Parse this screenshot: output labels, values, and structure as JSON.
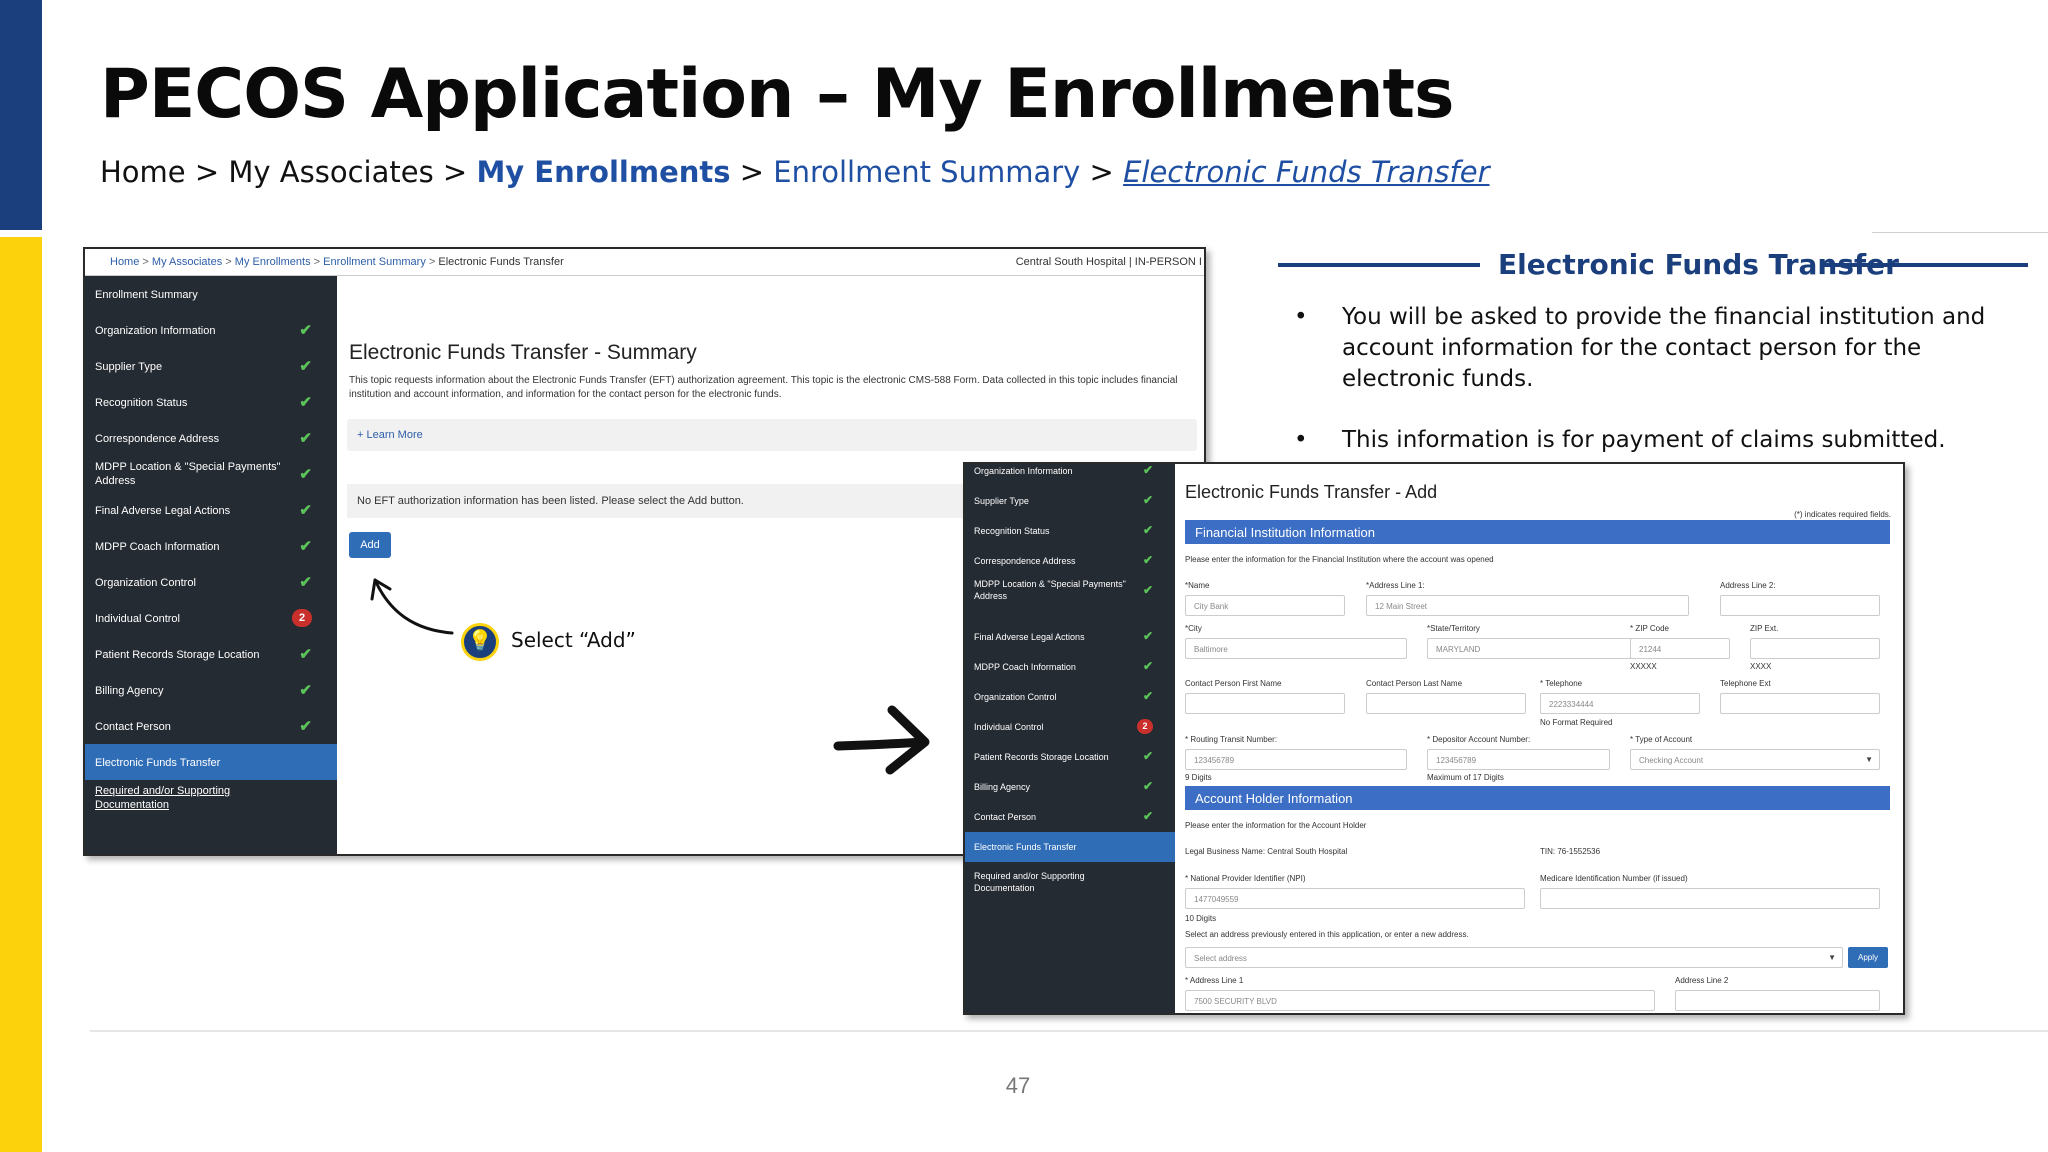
{
  "slide": {
    "title": "PECOS Application – My Enrollments",
    "page_number": "47",
    "colors": {
      "navy": "#1b3f7d",
      "yellow": "#fcd20c",
      "link_blue": "#1f4fa3"
    }
  },
  "breadcrumb": {
    "home": "Home",
    "my_associates": "My Associates",
    "my_enrollments": "My Enrollments",
    "enrollment_summary": "Enrollment Summary",
    "eft": "Electronic Funds Transfer",
    "separator": ">"
  },
  "info_panel": {
    "heading": "Electronic Funds Transfer",
    "bullets": [
      "You will be asked to provide the financial institution and account information for the contact person for the electronic funds.",
      "This information is for payment of claims submitted."
    ],
    "bullet_glyph": "•"
  },
  "annotation": {
    "text": "Select “Add”",
    "icon": "lightbulb-icon"
  },
  "screen1": {
    "breadcrumb": [
      "Home",
      "My Associates",
      "My Enrollments",
      "Enrollment Summary",
      "Electronic Funds Transfer"
    ],
    "org": "Central South Hospital  |  IN-PERSON I",
    "sidebar": [
      {
        "label": "Enrollment Summary",
        "status": ""
      },
      {
        "label": "Organization Information",
        "status": "check"
      },
      {
        "label": "Supplier Type",
        "status": "check"
      },
      {
        "label": "Recognition Status",
        "status": "check"
      },
      {
        "label": "Correspondence Address",
        "status": "check"
      },
      {
        "label": "MDPP Location & \"Special Payments\" Address",
        "status": "check"
      },
      {
        "label": "Final Adverse Legal Actions",
        "status": "check"
      },
      {
        "label": "MDPP Coach Information",
        "status": "check"
      },
      {
        "label": "Organization Control",
        "status": "check"
      },
      {
        "label": "Individual Control",
        "status": "2"
      },
      {
        "label": "Patient Records Storage Location",
        "status": "check"
      },
      {
        "label": "Billing Agency",
        "status": "check"
      },
      {
        "label": "Contact Person",
        "status": "check"
      },
      {
        "label": "Electronic Funds Transfer",
        "status": "active"
      },
      {
        "label": "Required and/or Supporting Documentation",
        "status": "link"
      }
    ],
    "page_title": "Electronic Funds Transfer - Summary",
    "description": "This topic requests information about the Electronic Funds Transfer (EFT) authorization agreement. This topic is the electronic CMS-588 Form. Data collected in this topic includes financial institution and account information, and information for the contact person for the electronic funds.",
    "learn_more": "+ Learn More",
    "empty_note": "No EFT authorization information has been listed. Please select the Add button.",
    "add_button": "Add"
  },
  "screen2": {
    "sidebar": [
      {
        "label": "Organization Information",
        "status": "check"
      },
      {
        "label": "Supplier Type",
        "status": "check"
      },
      {
        "label": "Recognition Status",
        "status": "check"
      },
      {
        "label": "Correspondence Address",
        "status": "check"
      },
      {
        "label": "MDPP Location & \"Special Payments\" Address",
        "status": "check"
      },
      {
        "label": "Final Adverse Legal Actions",
        "status": "check"
      },
      {
        "label": "MDPP Coach Information",
        "status": "check"
      },
      {
        "label": "Organization Control",
        "status": "check"
      },
      {
        "label": "Individual Control",
        "status": "2"
      },
      {
        "label": "Patient Records Storage Location",
        "status": "check"
      },
      {
        "label": "Billing Agency",
        "status": "check"
      },
      {
        "label": "Contact Person",
        "status": "check"
      },
      {
        "label": "Electronic Funds Transfer",
        "status": "active"
      },
      {
        "label": "Required and/or Supporting Documentation",
        "status": ""
      }
    ],
    "page_title": "Electronic Funds Transfer - Add",
    "required_note": "(*) indicates required fields.",
    "fin_section": "Financial Institution Information",
    "fin_intro": "Please enter the information for the Financial Institution where the account was opened",
    "labels": {
      "name": "*Name",
      "addr1": "*Address Line 1:",
      "addr2": "Address Line 2:",
      "city": "*City",
      "state": "*State/Territory",
      "zip": "* ZIP Code",
      "zip_ext": "ZIP Ext.",
      "cp_first": "Contact Person First Name",
      "cp_last": "Contact Person Last Name",
      "telephone": "* Telephone",
      "tel_ext": "Telephone Ext",
      "routing": "* Routing Transit Number:",
      "depositor": "* Depositor Account Number:",
      "acct_type": "* Type of Account",
      "legal_name": "Legal Business Name: Central South Hospital",
      "tin": "TIN: 76-1552536",
      "npi": "* National Provider Identifier (NPI)",
      "medicare_id": "Medicare Identification Number (if issued)",
      "select_addr_intro": "Select an address previously entered in this application, or enter a new address.",
      "ah_addr1": "* Address Line 1",
      "ah_addr2": "Address Line 2"
    },
    "placeholders": {
      "name": "City Bank",
      "addr1": "12 Main Street",
      "city": "Baltimore",
      "state": "MARYLAND",
      "zip": "21244",
      "telephone": "2223334444",
      "routing": "123456789",
      "depositor": "123456789",
      "acct_type": "Checking Account",
      "npi": "1477049559",
      "select_address": "Select address",
      "ah_addr1": "7500 SECURITY BLVD"
    },
    "hints": {
      "zip": "XXXXX",
      "zip_ext": "XXXX",
      "telephone": "No Format Required",
      "routing": "9 Digits",
      "depositor": "Maximum of 17 Digits",
      "npi": "10 Digits"
    },
    "ah_section": "Account Holder Information",
    "ah_intro": "Please enter the information for the Account Holder",
    "apply_button": "Apply"
  }
}
